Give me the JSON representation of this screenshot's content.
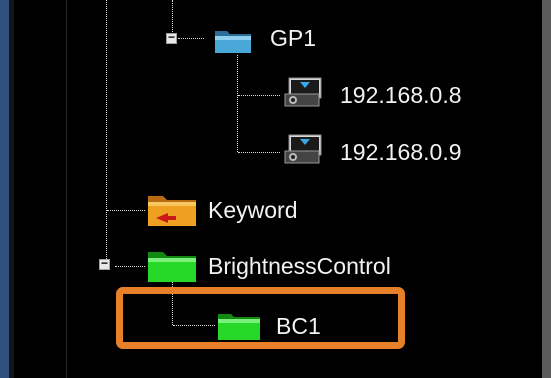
{
  "tree": {
    "nodes": [
      {
        "name": "gp1",
        "label": "GP1",
        "icon": "folder-icon",
        "expanded": true
      },
      {
        "name": "ip-192-168-0-8",
        "label": "192.168.0.8",
        "icon": "projector-icon"
      },
      {
        "name": "ip-192-168-0-9",
        "label": "192.168.0.9",
        "icon": "projector-icon"
      },
      {
        "name": "keyword",
        "label": "Keyword",
        "icon": "folder-icon"
      },
      {
        "name": "brightness-control",
        "label": "BrightnessControl",
        "icon": "folder-icon",
        "expanded": true
      },
      {
        "name": "bc1",
        "label": "BC1",
        "icon": "folder-icon",
        "highlighted": true
      }
    ]
  },
  "colors": {
    "background": "#000000",
    "text": "#f2f2f2",
    "highlight": "#e8802a",
    "folder_blue": "#4aa8d8",
    "folder_orange": "#f0a020",
    "folder_green": "#28d828"
  }
}
